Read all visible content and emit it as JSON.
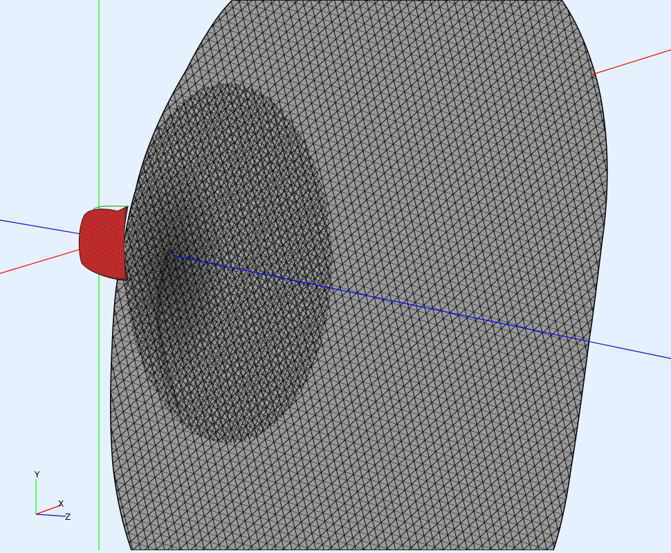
{
  "viewport": {
    "background": "#e6f1ff",
    "mesh_fill": "#9a9a9a",
    "mesh_line": "#000000",
    "throat_fill": "#7a2a2a",
    "throat_line": "#ff2020"
  },
  "axes": {
    "x_color": "#ff0000",
    "y_color": "#00ff00",
    "z_color": "#0000ff"
  },
  "triad": {
    "x_label": "X",
    "y_label": "Y",
    "z_label": "Z"
  }
}
